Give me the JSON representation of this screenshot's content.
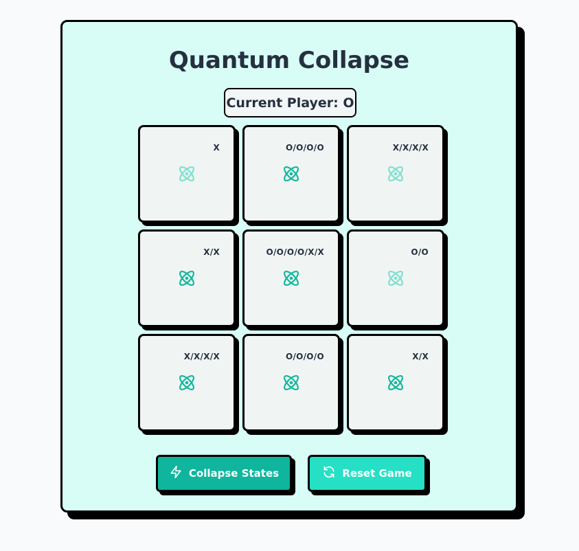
{
  "game": {
    "title": "Quantum Collapse",
    "current_player_label": "Current Player: O",
    "cells": [
      {
        "label": "X",
        "faded": true
      },
      {
        "label": "O/O/O/O",
        "faded": false
      },
      {
        "label": "X/X/X/X",
        "faded": true
      },
      {
        "label": "X/X",
        "faded": false
      },
      {
        "label": "O/O/O/O/X/X",
        "faded": false
      },
      {
        "label": "O/O",
        "faded": true
      },
      {
        "label": "X/X/X/X",
        "faded": false
      },
      {
        "label": "O/O/O/O",
        "faded": false
      },
      {
        "label": "X/X",
        "faded": false
      }
    ]
  },
  "controls": {
    "collapse_label": "Collapse States",
    "reset_label": "Reset Game"
  },
  "colors": {
    "atom": "#12b89c",
    "atom_faded": "#7fe0cf",
    "collapse_bg": "#0fb59c",
    "reset_bg": "#25e0c4"
  },
  "icons": {
    "cell": "atom-icon",
    "collapse": "lightning-icon",
    "reset": "refresh-icon"
  }
}
